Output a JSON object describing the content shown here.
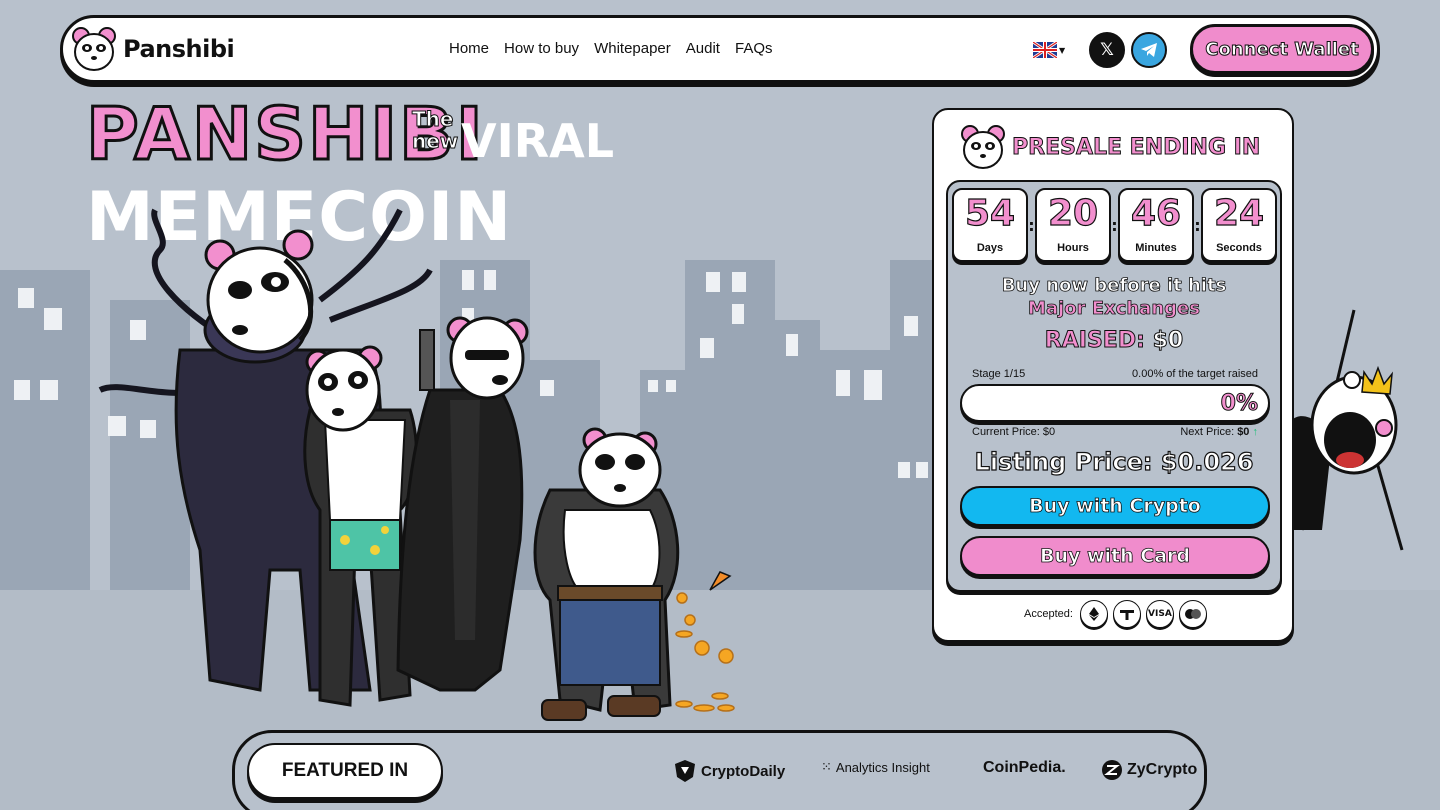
{
  "brand": {
    "name": "Panshibi"
  },
  "nav": {
    "links": [
      "Home",
      "How to buy",
      "Whitepaper",
      "Audit",
      "FAQs"
    ],
    "language_icon": "uk-flag-icon",
    "connect_label": "Connect Wallet"
  },
  "hero": {
    "title": "PANSHIBI",
    "the": "The",
    "new": "new",
    "viral": "VIRAL",
    "memecoin": "MEMECOIN"
  },
  "presale": {
    "heading": "PRESALE ENDING IN",
    "timer": [
      {
        "value": "54",
        "label": "Days"
      },
      {
        "value": "20",
        "label": "Hours"
      },
      {
        "value": "46",
        "label": "Minutes"
      },
      {
        "value": "24",
        "label": "Seconds"
      }
    ],
    "buy_before": "Buy now before it hits",
    "major_exchanges": "Major Exchanges",
    "raised_label": "RAISED:",
    "raised_value": "$0",
    "stage": "Stage 1/15",
    "target_raised": "0.00% of the target raised",
    "progress_pct": "0%",
    "progress_fraction": 0,
    "current_price": "Current Price: $0",
    "next_price_label": "Next Price:",
    "next_price_value": "$0",
    "listing_price": "Listing Price: $0.026",
    "buy_crypto": "Buy with Crypto",
    "buy_card": "Buy with Card",
    "accepted_label": "Accepted:",
    "payment_icons": [
      "ethereum-icon",
      "tether-icon",
      "visa-icon",
      "mastercard-icon"
    ],
    "visa_text": "VISA"
  },
  "featured": {
    "label": "FEATURED IN",
    "media": [
      "CryptoDaily",
      "Analytics Insight",
      "CoinPedia.",
      "ZyCrypto"
    ]
  },
  "colors": {
    "background": "#b8c1cc",
    "pink": "#f28fce",
    "cyan": "#12b8f0",
    "telegram": "#3aa6e0"
  }
}
